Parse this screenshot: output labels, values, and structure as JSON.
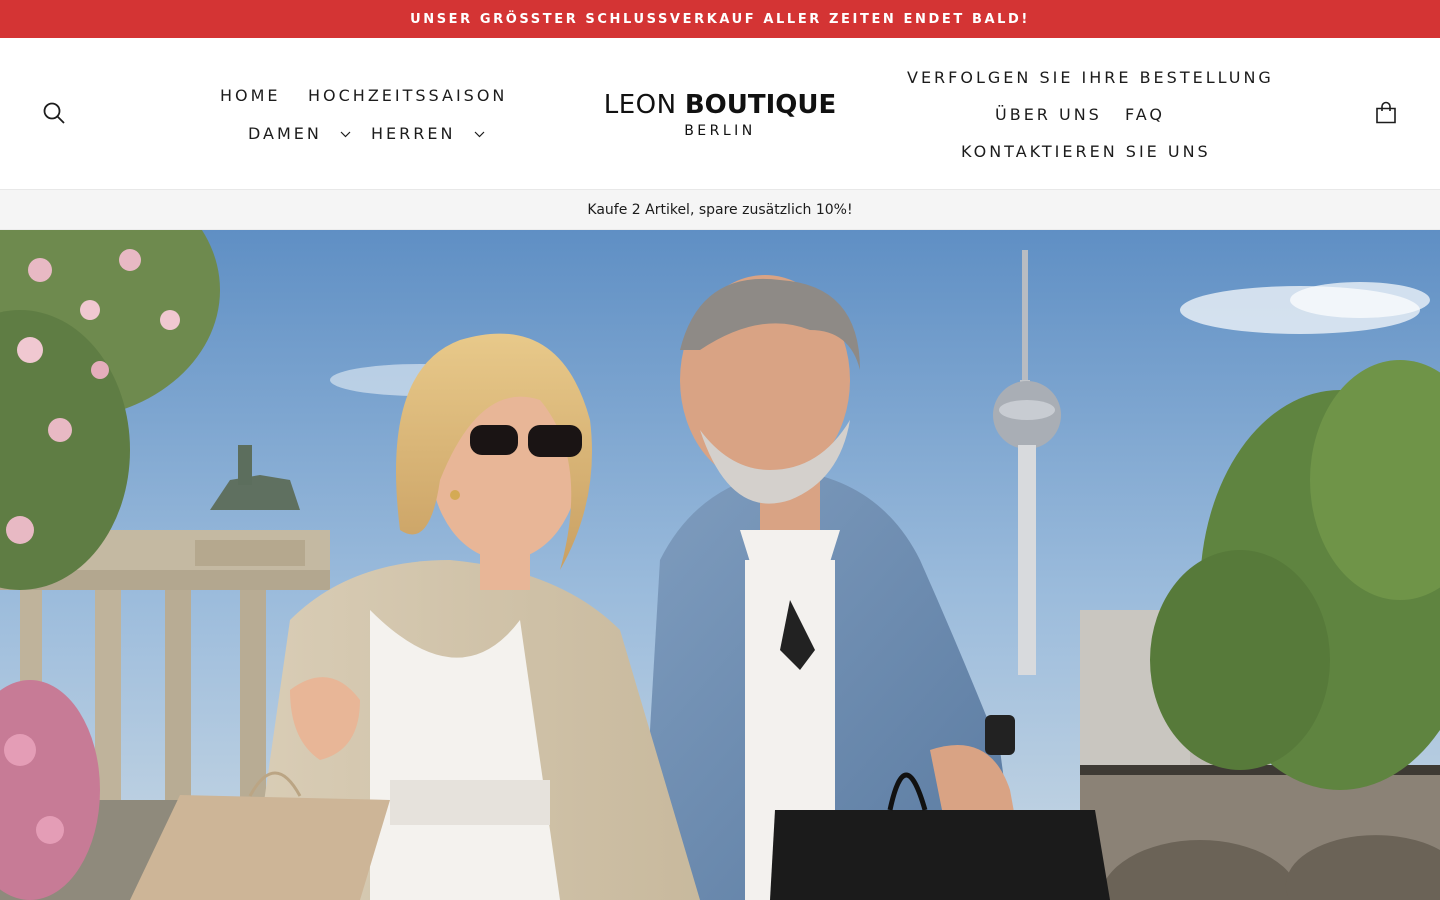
{
  "announcement": "UNSER GRÖSSTER SCHLUSSVERKAUF ALLER ZEITEN ENDET BALD!",
  "nav_left": [
    {
      "label": "HOME"
    },
    {
      "label": "HOCHZEITSSAISON"
    },
    {
      "label": "DAMEN",
      "dropdown": true
    },
    {
      "label": "HERREN",
      "dropdown": true
    }
  ],
  "logo": {
    "light": "LEON",
    "bold": "BOUTIQUE",
    "sub": "BERLIN"
  },
  "nav_right": [
    {
      "label": "VERFOLGEN SIE IHRE BESTELLUNG"
    },
    {
      "label": "ÜBER UNS"
    },
    {
      "label": "FAQ"
    },
    {
      "label": "KONTAKTIEREN SIE UNS"
    }
  ],
  "icons": {
    "search": "search-icon",
    "cart": "cart-bag-icon",
    "dropdown": "chevron-down-icon"
  },
  "promo_bar": "Kaufe 2 Artikel, spare zusätzlich 10%!",
  "colors": {
    "announcement_bg": "#d43434",
    "promo_bg": "#f5f5f5",
    "text": "#1c1c1c"
  }
}
